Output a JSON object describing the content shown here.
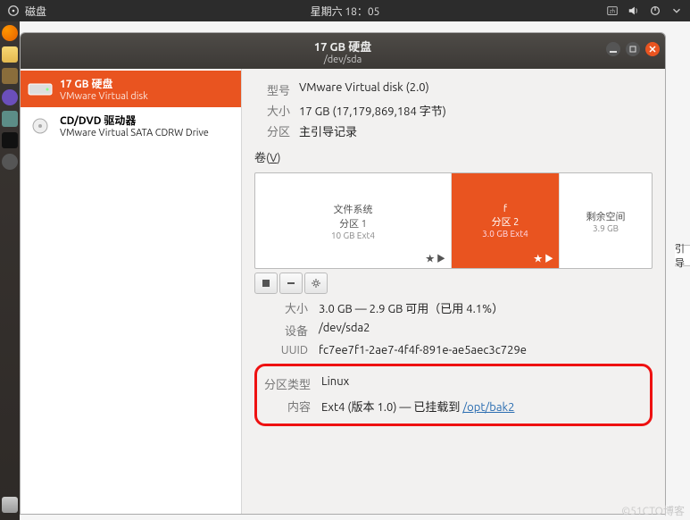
{
  "topbar": {
    "app_label": "磁盘",
    "clock": "星期六 18：05",
    "indicators": {
      "lang": "zh",
      "network": "wired",
      "volume": "on",
      "power": "on"
    }
  },
  "window": {
    "title": "17 GB 硬盘",
    "subtitle": "/dev/sda",
    "controls": {
      "minimize": "–",
      "maximize": "□",
      "close": "×"
    }
  },
  "sidebar": {
    "items": [
      {
        "icon": "hdd",
        "line1": "17 GB 硬盘",
        "line2": "VMware Virtual disk",
        "active": true
      },
      {
        "icon": "cd",
        "line1": "CD/DVD 驱动器",
        "line2": "VMware Virtual SATA CDRW Drive",
        "active": false
      }
    ]
  },
  "detail": {
    "model_label": "型号",
    "model_value": "VMware Virtual disk (2.0)",
    "size_label": "大小",
    "size_value": "17 GB (17,179,869,184 字节)",
    "parttable_label": "分区",
    "parttable_value": "主引导记录",
    "volumes_label_prefix": "卷(",
    "volumes_label_key": "V",
    "volumes_label_suffix": ")"
  },
  "volumes": [
    {
      "name": "文件系统",
      "partition": "分区 1",
      "size": "10 GB Ext4",
      "marks": "★ ▶",
      "selected": false
    },
    {
      "name": "f",
      "partition": "分区 2",
      "size": "3.0 GB Ext4",
      "marks": "★ ▶",
      "selected": true
    },
    {
      "name": "剩余空间",
      "partition": "",
      "size": "3.9 GB",
      "marks": "",
      "selected": false
    }
  ],
  "toolbar": {
    "unmount": "■",
    "delete": "–",
    "options": "⚙"
  },
  "volume_detail": {
    "size_label": "大小",
    "size_value": "3.0 GB — 2.9 GB 可用（已用 4.1%）",
    "device_label": "设备",
    "device_value": "/dev/sda2",
    "uuid_label": "UUID",
    "uuid_value": "fc7ee7f1-2ae7-4f4f-891e-ae5aec3c729e",
    "type_label": "分区类型",
    "type_value": "Linux",
    "content_label": "内容",
    "content_prefix": "Ext4 (版本 1.0) — 已挂载到 ",
    "content_link": "/opt/bak2"
  },
  "side_tab": "引导",
  "watermark": "©51CTO博客"
}
